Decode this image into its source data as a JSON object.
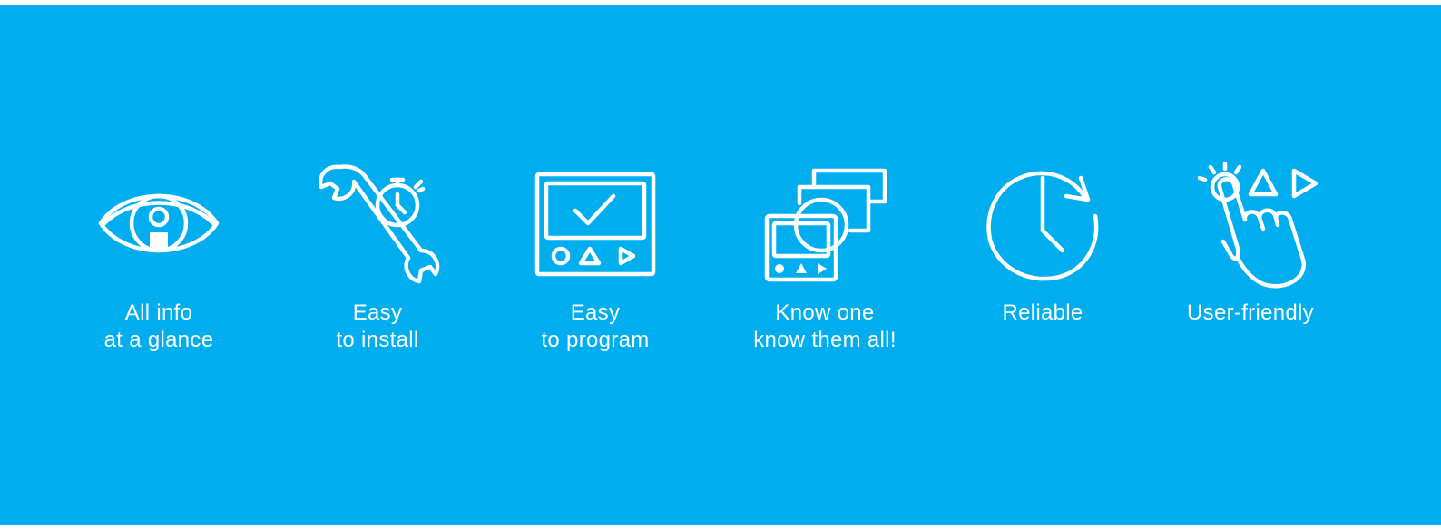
{
  "colors": {
    "background": "#00aeef",
    "foreground": "#ffffff"
  },
  "features": [
    {
      "icon": "eye-icon",
      "line1": "All info",
      "line2": "at a glance"
    },
    {
      "icon": "wrench-stopwatch-icon",
      "line1": "Easy",
      "line2": "to install"
    },
    {
      "icon": "display-checkmark-icon",
      "line1": "Easy",
      "line2": "to program"
    },
    {
      "icon": "stacked-devices-icon",
      "line1": "Know one",
      "line2": "know them all!"
    },
    {
      "icon": "clock-icon",
      "line1": "Reliable",
      "line2": ""
    },
    {
      "icon": "pointing-hand-icon",
      "line1": "User-friendly",
      "line2": ""
    }
  ]
}
